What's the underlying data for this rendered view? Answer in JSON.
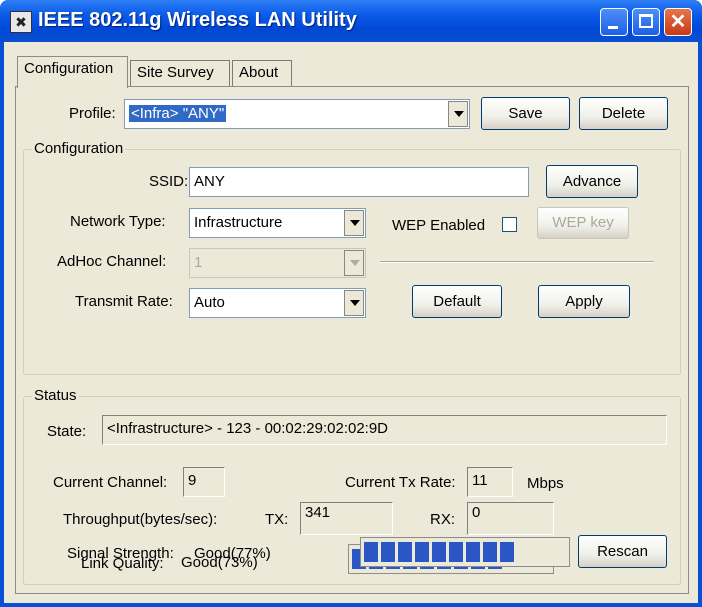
{
  "window": {
    "title": "IEEE 802.11g Wireless LAN Utility",
    "icon": "app-icon",
    "controls": [
      "minimize-icon",
      "maximize-icon",
      "close-icon"
    ]
  },
  "tabs": [
    {
      "label": "Configuration",
      "active": true
    },
    {
      "label": "Site Survey",
      "active": false
    },
    {
      "label": "About",
      "active": false
    }
  ],
  "profile": {
    "label": "Profile:",
    "value": "<Infra> \"ANY\"",
    "save_label": "Save",
    "delete_label": "Delete"
  },
  "configuration": {
    "group_title": "Configuration",
    "ssid_label": "SSID:",
    "ssid_value": "ANY",
    "advance_label": "Advance",
    "network_type_label": "Network Type:",
    "network_type_value": "Infrastructure",
    "wep_enabled_label": "WEP Enabled",
    "wep_enabled_checked": false,
    "wep_key_label": "WEP key",
    "adhoc_channel_label": "AdHoc Channel:",
    "adhoc_channel_value": "1",
    "transmit_rate_label": "Transmit Rate:",
    "transmit_rate_value": "Auto",
    "default_label": "Default",
    "apply_label": "Apply"
  },
  "status": {
    "group_title": "Status",
    "state_label": "State:",
    "state_value": "<Infrastructure> - 123 - 00:02:29:02:02:9D",
    "current_channel_label": "Current Channel:",
    "current_channel_value": "9",
    "current_tx_rate_label": "Current Tx Rate:",
    "current_tx_rate_value": "11",
    "tx_rate_unit": "Mbps",
    "throughput_label": "Throughput(bytes/sec):",
    "tx_label": "TX:",
    "tx_value": "341",
    "rx_label": "RX:",
    "rx_value": "0",
    "link_quality_label": "Link Quality:",
    "link_quality_value": "Good(73%)",
    "link_quality_percent": 73,
    "signal_strength_label": "Signal Strength:",
    "signal_strength_value": "Good(77%)",
    "signal_strength_percent": 77,
    "rescan_label": "Rescan"
  },
  "colors": {
    "titlebar": "#0a4fd6",
    "dialog_bg": "#ece9d8",
    "progress_fill": "#2a56c6",
    "selection": "#316ac5"
  }
}
